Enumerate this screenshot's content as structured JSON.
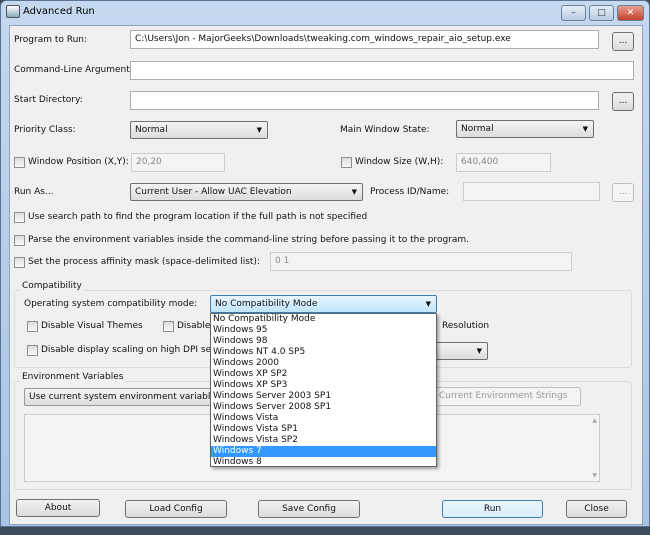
{
  "window": {
    "title": "Advanced Run",
    "minimize": "–",
    "maximize": "□",
    "close": "✕"
  },
  "fields": {
    "program_label": "Program to Run:",
    "program_value": "C:\\Users\\Jon - MajorGeeks\\Downloads\\tweaking.com_windows_repair_aio_setup.exe",
    "browse": "...",
    "args_label": "Command-Line Arguments:",
    "args_value": "",
    "startdir_label": "Start Directory:",
    "startdir_value": "",
    "priority_label": "Priority Class:",
    "priority_value": "Normal",
    "winstate_label": "Main Window State:",
    "winstate_value": "Normal",
    "winpos_label": "Window Position (X,Y):",
    "winpos_value": "20,20",
    "winsize_label": "Window Size (W,H):",
    "winsize_value": "640,400",
    "runas_label": "Run As...",
    "runas_value": "Current User - Allow UAC Elevation",
    "pid_label": "Process ID/Name:",
    "pid_value": ""
  },
  "checks": {
    "search_path": "Use search path to find the program location if the full path is not specified",
    "parse_env": "Parse the environment variables inside the command-line string before passing it to the program.",
    "affinity": "Set the process affinity mask (space-delimited list):",
    "affinity_value": "0 1"
  },
  "compat": {
    "group": "Compatibility",
    "os_label": "Operating system compatibility mode:",
    "os_value": "No Compatibility Mode",
    "visual_themes": "Disable Visual Themes",
    "disable_d": "Disable d",
    "resolution": "Resolution",
    "dpi": "Disable display scaling on high DPI settings",
    "options": [
      "No Compatibility Mode",
      "Windows 95",
      "Windows 98",
      "Windows NT 4.0 SP5",
      "Windows 2000",
      "Windows XP SP2",
      "Windows XP SP3",
      "Windows Server 2003 SP1",
      "Windows Server 2008 SP1",
      "Windows Vista",
      "Windows Vista SP1",
      "Windows Vista SP2",
      "Windows 7",
      "Windows 8"
    ],
    "highlighted": "Windows 7"
  },
  "env": {
    "group": "Environment Variables",
    "select_value": "Use current system environment variables wit",
    "button": "ll Current Environment Strings"
  },
  "buttons": {
    "about": "About",
    "load": "Load Config",
    "save": "Save Config",
    "run": "Run",
    "close": "Close"
  }
}
